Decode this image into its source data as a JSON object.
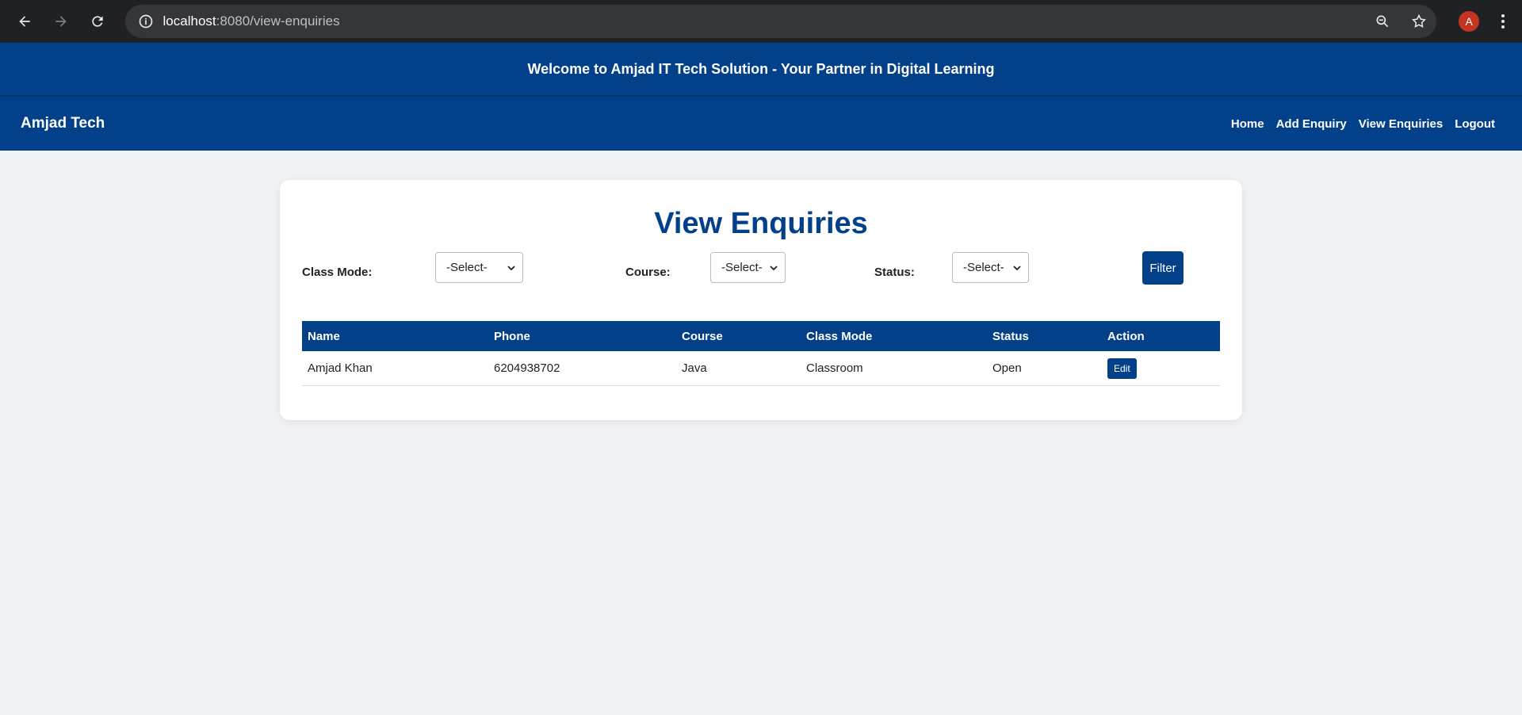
{
  "browser": {
    "url_host": "localhost",
    "url_rest": ":8080/view-enquiries",
    "avatar_letter": "A"
  },
  "banner": {
    "text": "Welcome to Amjad IT Tech Solution - Your Partner in Digital Learning"
  },
  "navbar": {
    "brand": "Amjad Tech",
    "links": [
      "Home",
      "Add Enquiry",
      "View Enquiries",
      "Logout"
    ]
  },
  "page": {
    "title": "View Enquiries",
    "filters": {
      "class_mode_label": "Class Mode:",
      "class_mode_value": "-Select-",
      "course_label": "Course:",
      "course_value": "-Select-",
      "status_label": "Status:",
      "status_value": "-Select-",
      "filter_button": "Filter"
    },
    "table": {
      "headers": [
        "Name",
        "Phone",
        "Course",
        "Class Mode",
        "Status",
        "Action"
      ],
      "rows": [
        {
          "name": "Amjad Khan",
          "phone": "6204938702",
          "course": "Java",
          "class_mode": "Classroom",
          "status": "Open",
          "action": "Edit"
        }
      ]
    }
  },
  "colors": {
    "primary": "#02418a",
    "background": "#f0f2f5",
    "avatar": "#c5341e"
  }
}
